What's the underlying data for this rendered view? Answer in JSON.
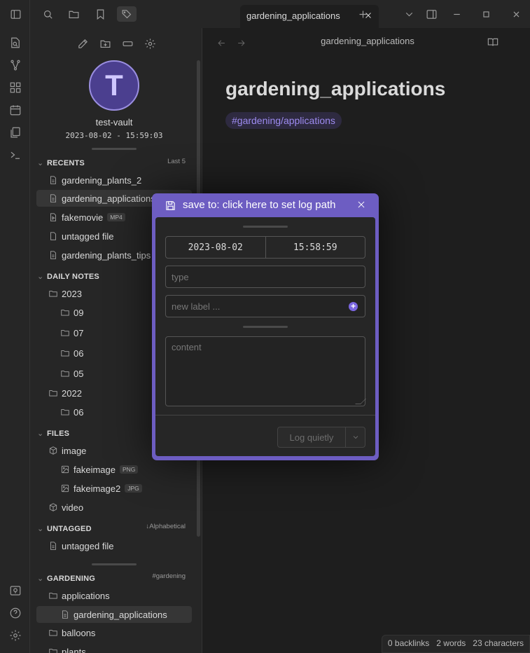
{
  "tab": {
    "title": "gardening_applications"
  },
  "sidebar": {
    "vault_initial": "T",
    "vault_name": "test-vault",
    "vault_datetime": "2023-08-02 - 15:59:03",
    "recents": {
      "header": "RECENTS",
      "aux": "Last 5",
      "items": [
        {
          "label": "gardening_plants_2"
        },
        {
          "label": "gardening_applications"
        },
        {
          "label": "fakemovie",
          "badge": "MP4"
        },
        {
          "label": "untagged file"
        },
        {
          "label": "gardening_plants_tips"
        }
      ]
    },
    "daily_notes": {
      "header": "DAILY NOTES",
      "year_2023": "2023",
      "months_2023": [
        "09",
        "07",
        "06",
        "05"
      ],
      "year_2022": "2022",
      "months_2022": [
        "06"
      ]
    },
    "files": {
      "header": "FILES",
      "image_folder": "image",
      "image_files": [
        {
          "label": "fakeimage",
          "badge": "PNG"
        },
        {
          "label": "fakeimage2",
          "badge": "JPG"
        }
      ],
      "video_folder": "video"
    },
    "untagged": {
      "header": "UNTAGGED",
      "aux": "↓Alphabetical",
      "items": [
        {
          "label": "untagged file"
        }
      ]
    },
    "gardening": {
      "header": "GARDENING",
      "aux": "#gardening",
      "folder_applications": "applications",
      "file": "gardening_applications",
      "folder_balloons": "balloons",
      "folder_plants": "plants"
    }
  },
  "main": {
    "view_title": "gardening_applications",
    "note_title": "gardening_applications",
    "tag": "#gardening/applications",
    "status": {
      "backlinks": "0 backlinks",
      "words": "2 words",
      "chars": "23 characters"
    }
  },
  "modal": {
    "header_text": "save to: click here to set log path",
    "date": "2023-08-02",
    "time": "15:58:59",
    "type_placeholder": "type",
    "label_placeholder": "new label ...",
    "content_placeholder": "content",
    "log_button": "Log quietly"
  },
  "colors": {
    "accent": "#6d5dc2",
    "tag_text": "#9d8bf0"
  }
}
